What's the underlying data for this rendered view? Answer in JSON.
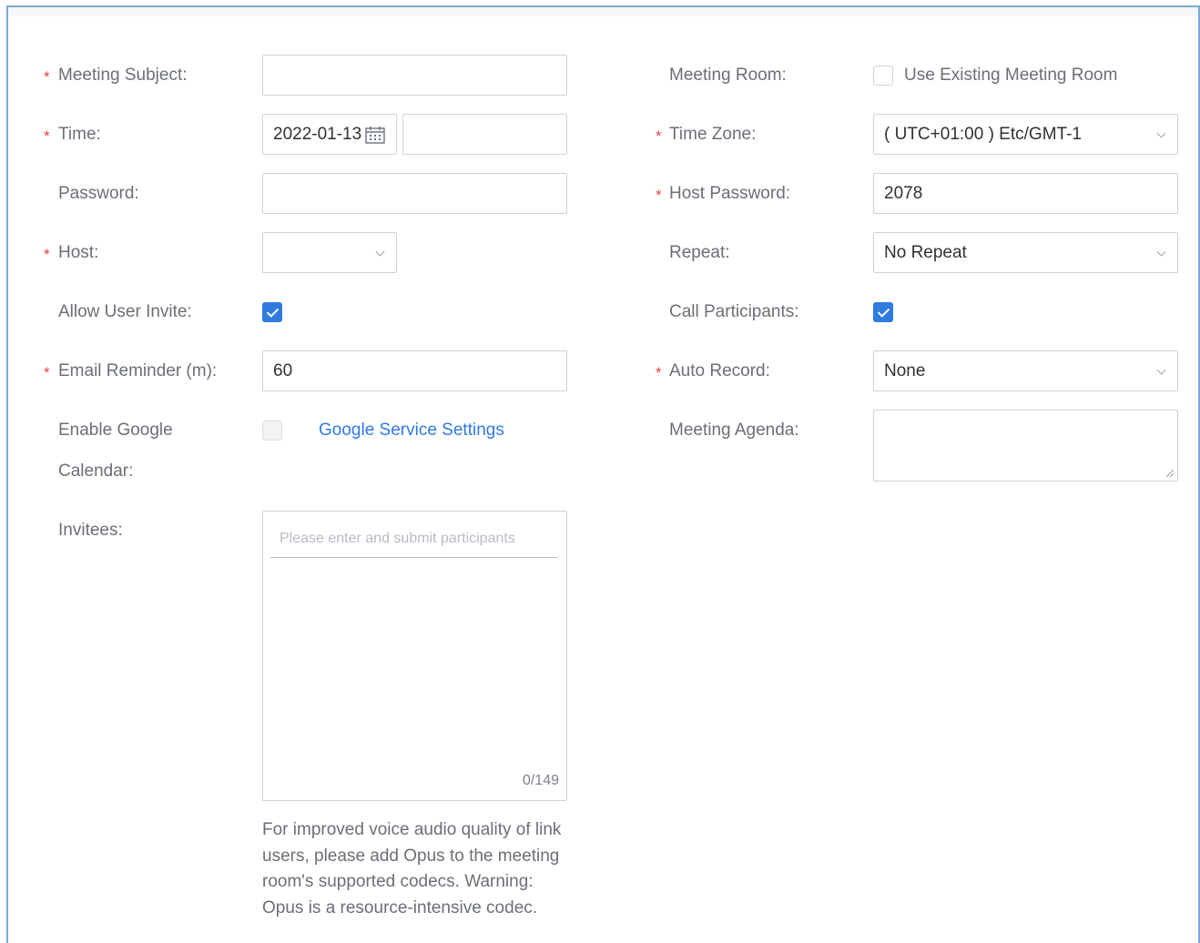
{
  "form": {
    "meeting_subject": {
      "label": "Meeting Subject:",
      "required": "*",
      "value": ""
    },
    "time": {
      "label": "Time:",
      "required": "*",
      "date_value": "2022-01-13",
      "time_value": ""
    },
    "password": {
      "label": "Password:",
      "value": ""
    },
    "host": {
      "label": "Host:",
      "required": "*",
      "value": ""
    },
    "allow_user_invite": {
      "label": "Allow User Invite:",
      "checked": true
    },
    "email_reminder": {
      "label": "Email Reminder (m):",
      "required": "*",
      "value": "60"
    },
    "google_calendar": {
      "label_line1": "Enable Google",
      "label_line2": "Calendar:",
      "checked": false,
      "link": "Google Service Settings"
    },
    "invitees": {
      "label": "Invitees:",
      "placeholder": "Please enter and submit participants",
      "count": "0/149"
    },
    "note": "For improved voice audio quality of link users, please add Opus to the meeting room's supported codecs. Warning: Opus is a resource-intensive codec.",
    "meeting_room": {
      "label": "Meeting Room:",
      "checkbox_label": "Use Existing Meeting Room",
      "checked": false
    },
    "time_zone": {
      "label": "Time Zone:",
      "required": "*",
      "value": "( UTC+01:00 ) Etc/GMT-1"
    },
    "host_password": {
      "label": "Host Password:",
      "required": "*",
      "value": "2078"
    },
    "repeat": {
      "label": "Repeat:",
      "value": "No Repeat"
    },
    "call_participants": {
      "label": "Call Participants:",
      "checked": true
    },
    "auto_record": {
      "label": "Auto Record:",
      "required": "*",
      "value": "None"
    },
    "meeting_agenda": {
      "label": "Meeting Agenda:",
      "value": ""
    }
  },
  "icons": {
    "calendar": "calendar-icon",
    "dropdown": "chevron-down-icon",
    "resize": "resize-handle-icon",
    "check": "check-icon"
  },
  "colors": {
    "accent": "#2f7be0",
    "required": "#e64340",
    "frame": "#7ea8d8",
    "label": "#6b6f76"
  }
}
